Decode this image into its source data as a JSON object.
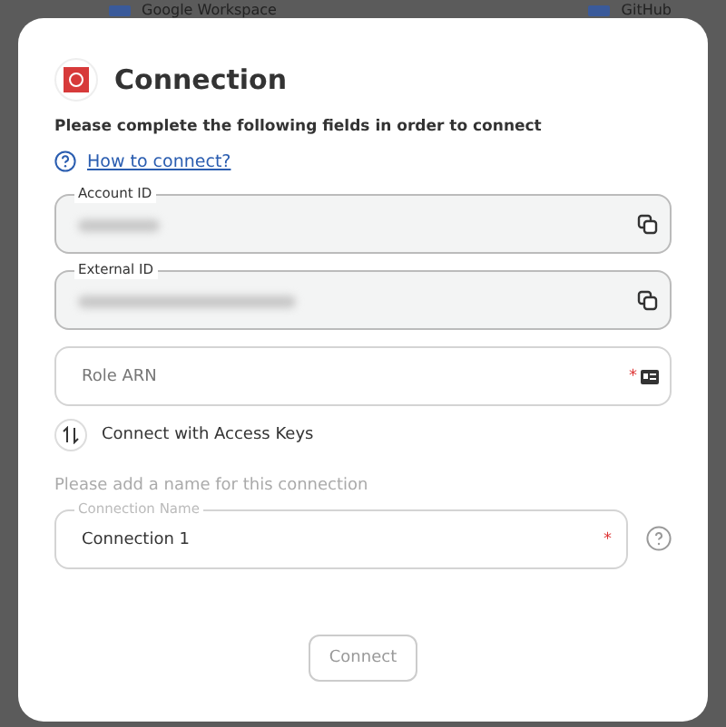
{
  "backdrop": {
    "items": [
      {
        "label": "Google Workspace"
      },
      {
        "label": "GitHub"
      }
    ]
  },
  "dialog": {
    "title": "Connection",
    "subtitle": "Please complete the following fields in order to connect",
    "help_link": "How to connect?",
    "fields": [
      {
        "kind": "copyable",
        "label": "Account ID",
        "disabled": true,
        "redacted": true
      },
      {
        "kind": "copyable",
        "label": "External ID",
        "disabled": true,
        "redacted": true
      },
      {
        "kind": "card_input",
        "placeholder": "Role ARN",
        "disabled": false,
        "redacted": false,
        "required_mark": "*"
      }
    ],
    "toggle": {
      "label": "Connect with Access Keys"
    },
    "name_hint": "Please add a name for this connection",
    "name_field": {
      "label": "Connection Name",
      "value": "Connection 1",
      "required_mark": "*"
    },
    "connect_button": {
      "label": "Connect",
      "disabled": true
    }
  }
}
